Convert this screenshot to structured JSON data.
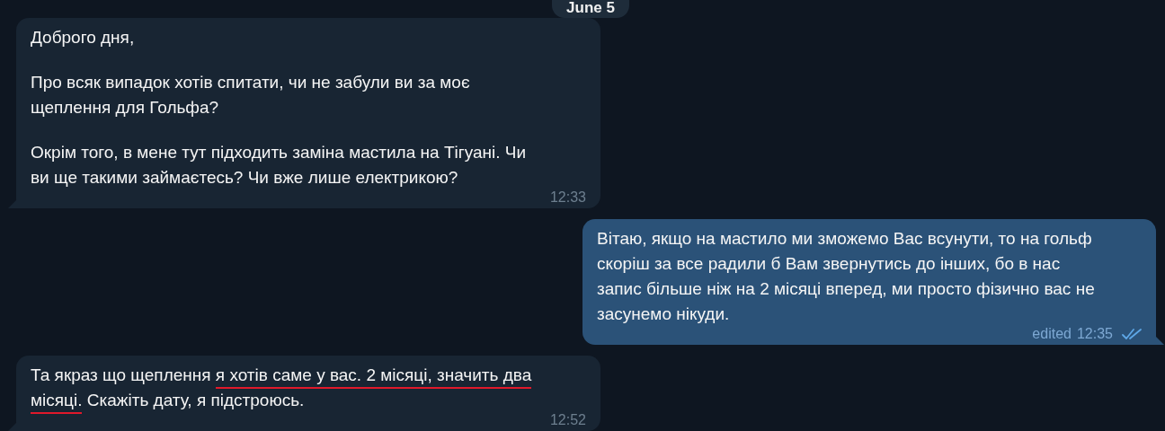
{
  "date_separator": "June 5",
  "messages": [
    {
      "kind": "incoming",
      "paragraphs": [
        [
          {
            "text": "Доброго дня,",
            "underlined": false
          }
        ],
        [
          {
            "text": "Про всяк випадок хотів спитати, чи не забули ви за моє щеплення для Гольфа?",
            "underlined": false
          }
        ],
        [
          {
            "text": "Окрім того, в мене тут підходить заміна мастила на Тігуані. Чи ви ще такими займаєтесь? Чи вже лише електрикою?",
            "underlined": false
          }
        ]
      ],
      "time": "12:33"
    },
    {
      "kind": "outgoing",
      "paragraphs": [
        [
          {
            "text": "Вітаю, якщо на мастило ми зможемо Вас всунути, то на гольф скоріш за все радили б Вам звернутись до інших, бо в нас запис більше ніж на 2 місяці вперед, ми просто фізично вас не засунемо нікуди.",
            "underlined": false
          }
        ]
      ],
      "edited": "edited",
      "time": "12:35",
      "read": true
    },
    {
      "kind": "incoming",
      "paragraphs": [
        [
          {
            "text": "Та якраз що щеплення ",
            "underlined": false
          },
          {
            "text": "я хотів саме у вас. 2 місяці, значить два місяці.",
            "underlined": true
          },
          {
            "text": " Скажіть дату, я підстроюсь.",
            "underlined": false
          }
        ]
      ],
      "time": "12:52"
    }
  ]
}
